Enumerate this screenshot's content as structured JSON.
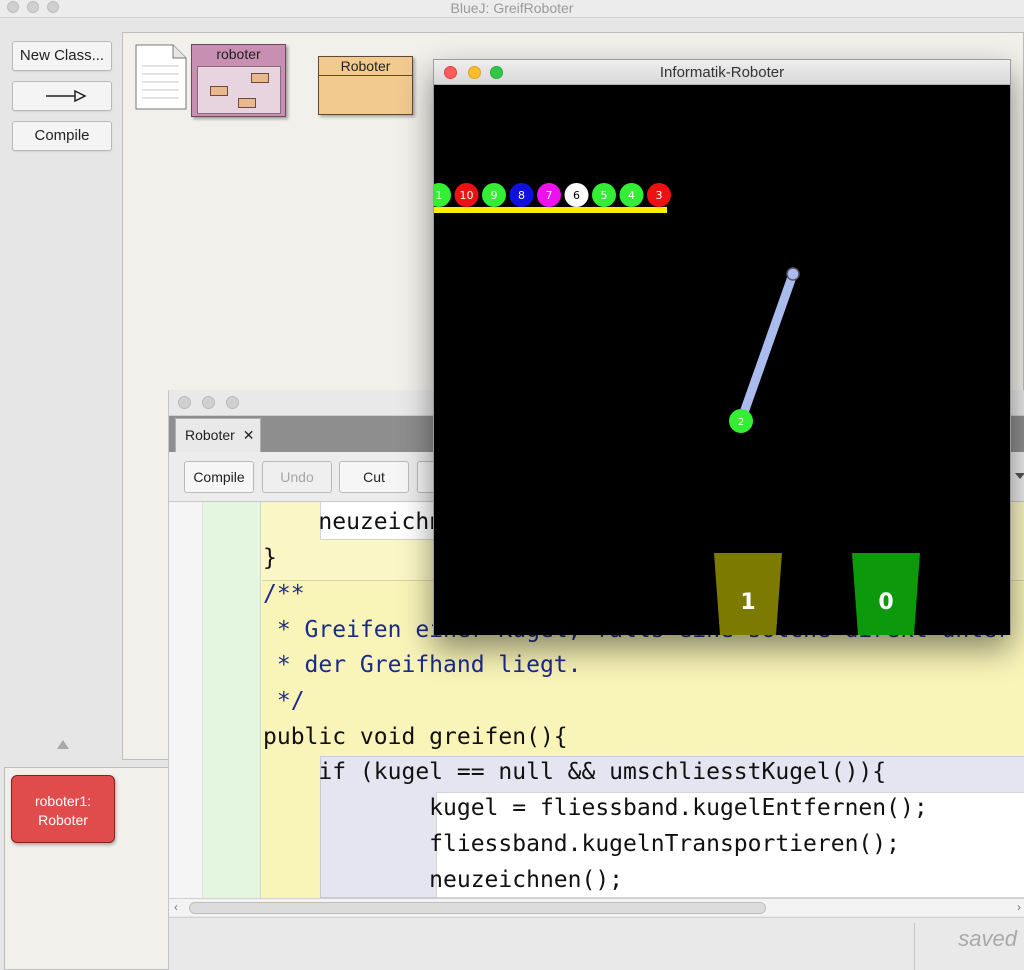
{
  "main_window": {
    "title": "BlueJ:  GreifRoboter"
  },
  "sidebar": {
    "new_class_label": "New Class...",
    "arrow_label": "——▷",
    "compile_label": "Compile"
  },
  "class_diagram": {
    "package_label": "roboter",
    "class_label": "Roboter"
  },
  "object_bench": {
    "object_label_line1": "roboter1:",
    "object_label_line2": "Roboter"
  },
  "editor": {
    "tab_label": "Roboter",
    "tab_close": "✕",
    "toolbar": {
      "compile": "Compile",
      "undo": "Undo",
      "cut": "Cut"
    },
    "status": "saved",
    "code": [
      "    neuzeichnen();",
      "}",
      "/**",
      " * Greifen einer Kugel, falls eine solche direkt unter",
      " * der Greifhand liegt.",
      " */",
      "public void greifen(){",
      "    if (kugel == null && umschliesstKugel()){",
      "            kugel = fliessband.kugelEntfernen();",
      "            fliessband.kugelnTransportieren();",
      "            neuzeichnen();"
    ]
  },
  "robot_window": {
    "title": "Informatik-Roboter",
    "conveyor_balls": [
      {
        "label": "1",
        "color": "#33ee33"
      },
      {
        "label": "10",
        "color": "#ee1111"
      },
      {
        "label": "9",
        "color": "#33ee33"
      },
      {
        "label": "8",
        "color": "#1111dd"
      },
      {
        "label": "7",
        "color": "#ee11ee"
      },
      {
        "label": "6",
        "color": "#ffffff"
      },
      {
        "label": "5",
        "color": "#33ee33"
      },
      {
        "label": "4",
        "color": "#33ee33"
      },
      {
        "label": "3",
        "color": "#ee1111"
      }
    ],
    "held_ball": {
      "label": "2",
      "color": "#33ee33"
    },
    "bins": [
      {
        "label": "1",
        "color": "#7d7a00"
      },
      {
        "label": "0",
        "color": "#0c9a0c"
      }
    ],
    "colors": {
      "conveyor": "#ffee00",
      "arm": "#aabbee",
      "background": "#000000"
    }
  }
}
